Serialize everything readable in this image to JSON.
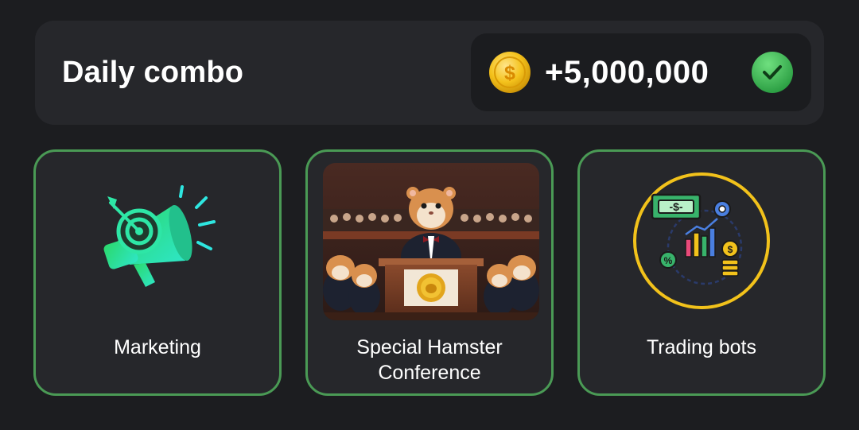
{
  "header": {
    "title": "Daily combo",
    "reward_amount": "+5,000,000",
    "coin_icon": "gold-dollar-coin-icon",
    "status_icon": "green-check-icon"
  },
  "cards": [
    {
      "label": "Marketing",
      "icon": "megaphone-target-icon"
    },
    {
      "label": "Special Hamster Conference",
      "image": "hamster-conference-illustration"
    },
    {
      "label": "Trading bots",
      "icon": "trading-bots-icon"
    }
  ],
  "colors": {
    "background": "#1c1d20",
    "panel": "#26272b",
    "card_border": "#4a9a55",
    "check_green": "#3fbf5a",
    "coin_gold": "#f4c21c",
    "accent_teal": "#2ee6a6"
  }
}
